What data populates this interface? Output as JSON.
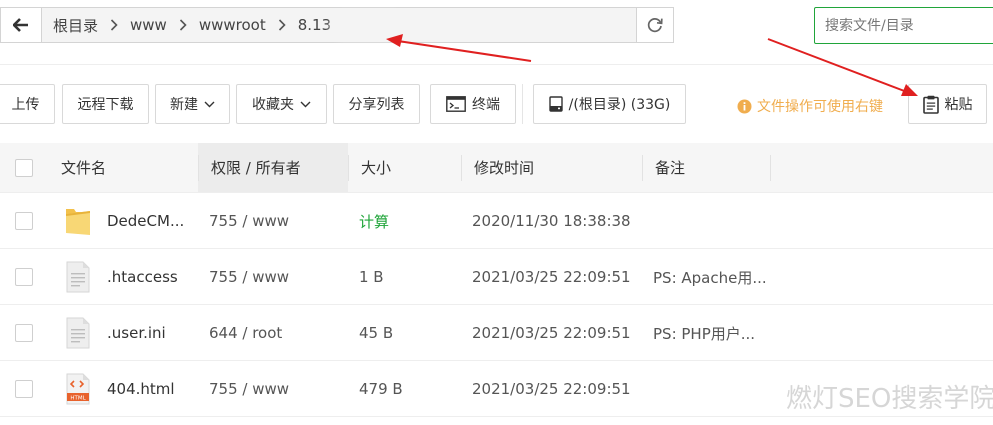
{
  "path_bar": {
    "crumbs": [
      "根目录",
      "www",
      "wwwroot",
      "8.13"
    ]
  },
  "search": {
    "placeholder": "搜索文件/目录"
  },
  "toolbar": {
    "upload": "上传",
    "remote_download": "远程下载",
    "new": "新建",
    "favorites": "收藏夹",
    "share_list": "分享列表",
    "terminal": "终端",
    "disk": "/(根目录) (33G)",
    "tip": "文件操作可使用右键",
    "paste": "粘贴"
  },
  "table": {
    "headers": {
      "name": "文件名",
      "perm": "权限 / 所有者",
      "size": "大小",
      "mtime": "修改时间",
      "note": "备注"
    },
    "rows": [
      {
        "name": "DedeCM...",
        "perm": "755 / www",
        "size": "计算",
        "mtime": "2020/11/30 18:38:38",
        "note": "",
        "icon": "folder-icon"
      },
      {
        "name": ".htaccess",
        "perm": "755 / www",
        "size": "1 B",
        "mtime": "2021/03/25 22:09:51",
        "note": "PS: Apache用...",
        "icon": "text-file-icon"
      },
      {
        "name": ".user.ini",
        "perm": "644 / root",
        "size": "45 B",
        "mtime": "2021/03/25 22:09:51",
        "note": "PS: PHP用户...",
        "icon": "text-file-icon"
      },
      {
        "name": "404.html",
        "perm": "755 / www",
        "size": "479 B",
        "mtime": "2021/03/25 22:09:51",
        "note": "",
        "icon": "html-file-icon"
      }
    ]
  },
  "watermark": "燃灯SEO搜索学院",
  "colors": {
    "accent_green": "#20a53a",
    "tip_orange": "#f0ad4e",
    "annotation_red": "#e02020"
  }
}
